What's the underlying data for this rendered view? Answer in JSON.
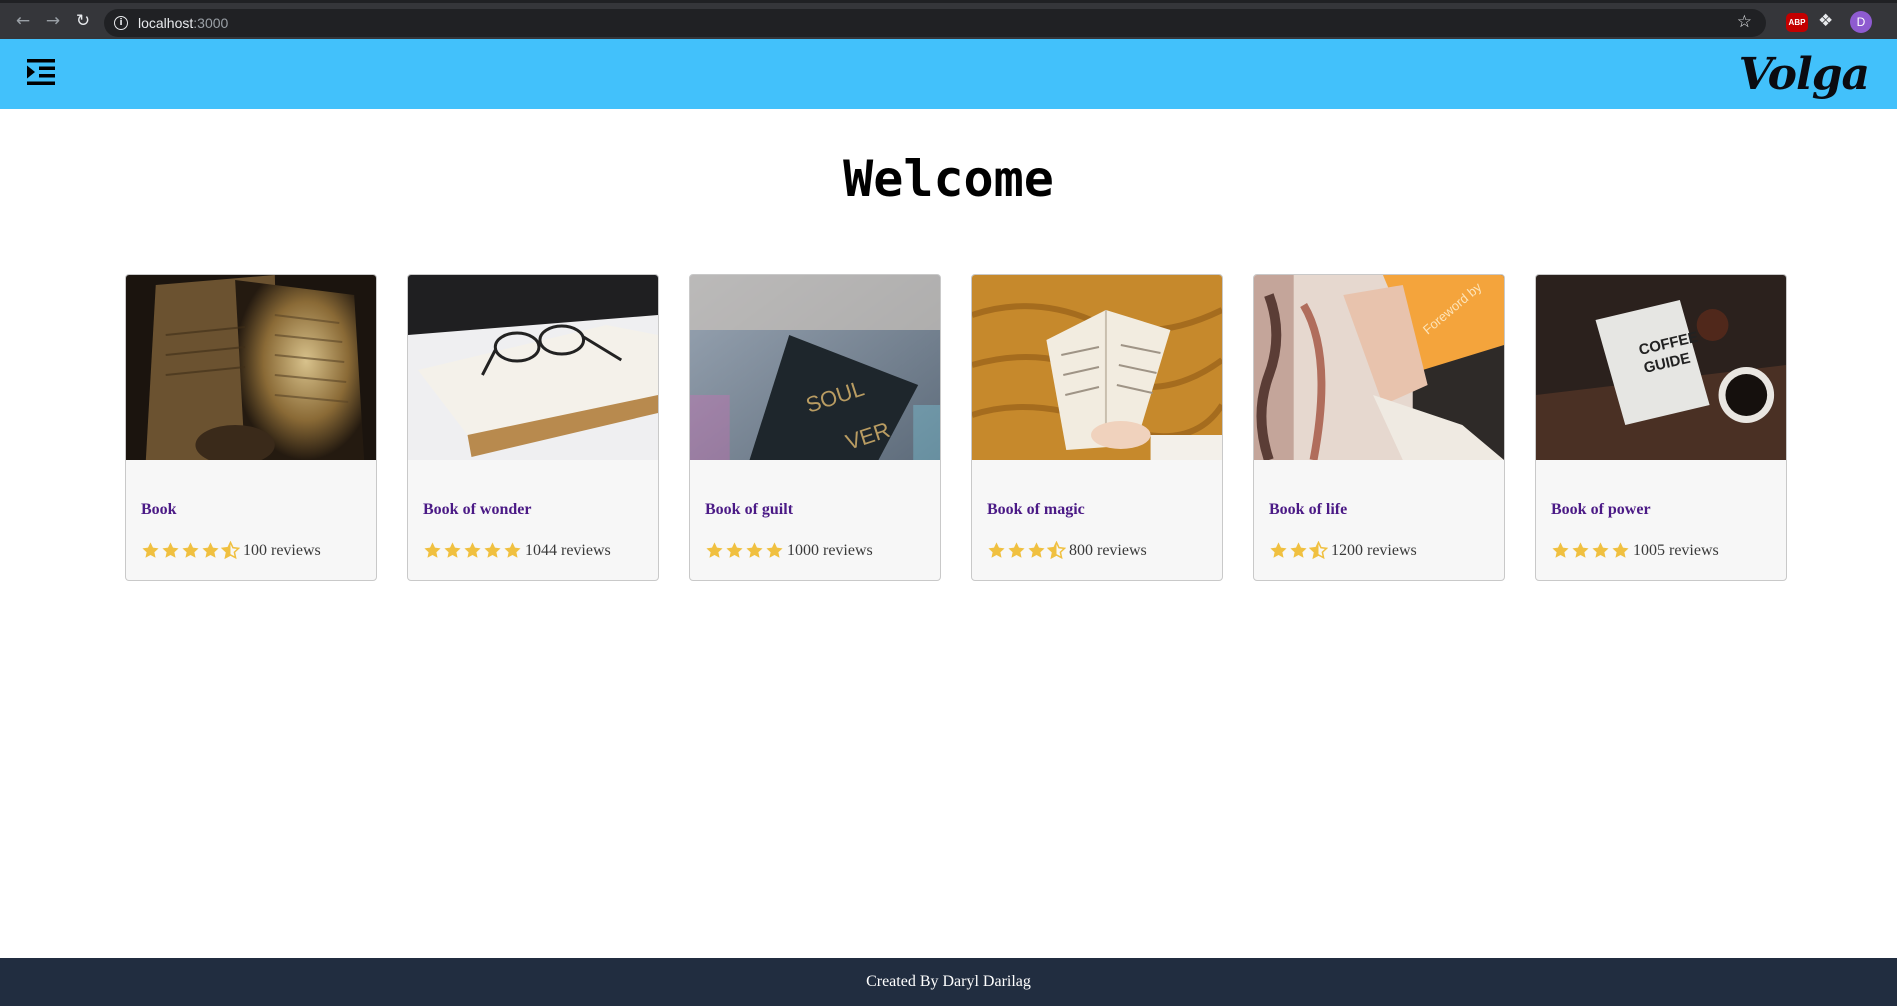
{
  "browser": {
    "url_host": "localhost",
    "url_port": ":3000",
    "back_icon": "arrow-left",
    "forward_icon": "arrow-right",
    "reload_icon": "reload",
    "bookmark_icon": "star",
    "abp_label": "ABP",
    "profile_initial": "D"
  },
  "header": {
    "brand": "Volga",
    "menu_icon": "menu-indent",
    "background_color": "#42c1fb"
  },
  "main": {
    "title": "Welcome"
  },
  "books": [
    {
      "title": "Book",
      "rating": 4.5,
      "reviews": "100 reviews"
    },
    {
      "title": "Book of wonder",
      "rating": 5,
      "reviews": "1044 reviews"
    },
    {
      "title": "Book of guilt",
      "rating": 4,
      "reviews": "1000 reviews"
    },
    {
      "title": "Book of magic",
      "rating": 3.5,
      "reviews": "800 reviews"
    },
    {
      "title": "Book of life",
      "rating": 2.5,
      "reviews": "1200 reviews"
    },
    {
      "title": "Book of power",
      "rating": 4,
      "reviews": "1005 reviews"
    }
  ],
  "colors": {
    "star": "#f0c040",
    "title": "#4b1a86",
    "footer_bg": "#212d40"
  },
  "footer": {
    "text": "Created By Daryl Darilag"
  }
}
